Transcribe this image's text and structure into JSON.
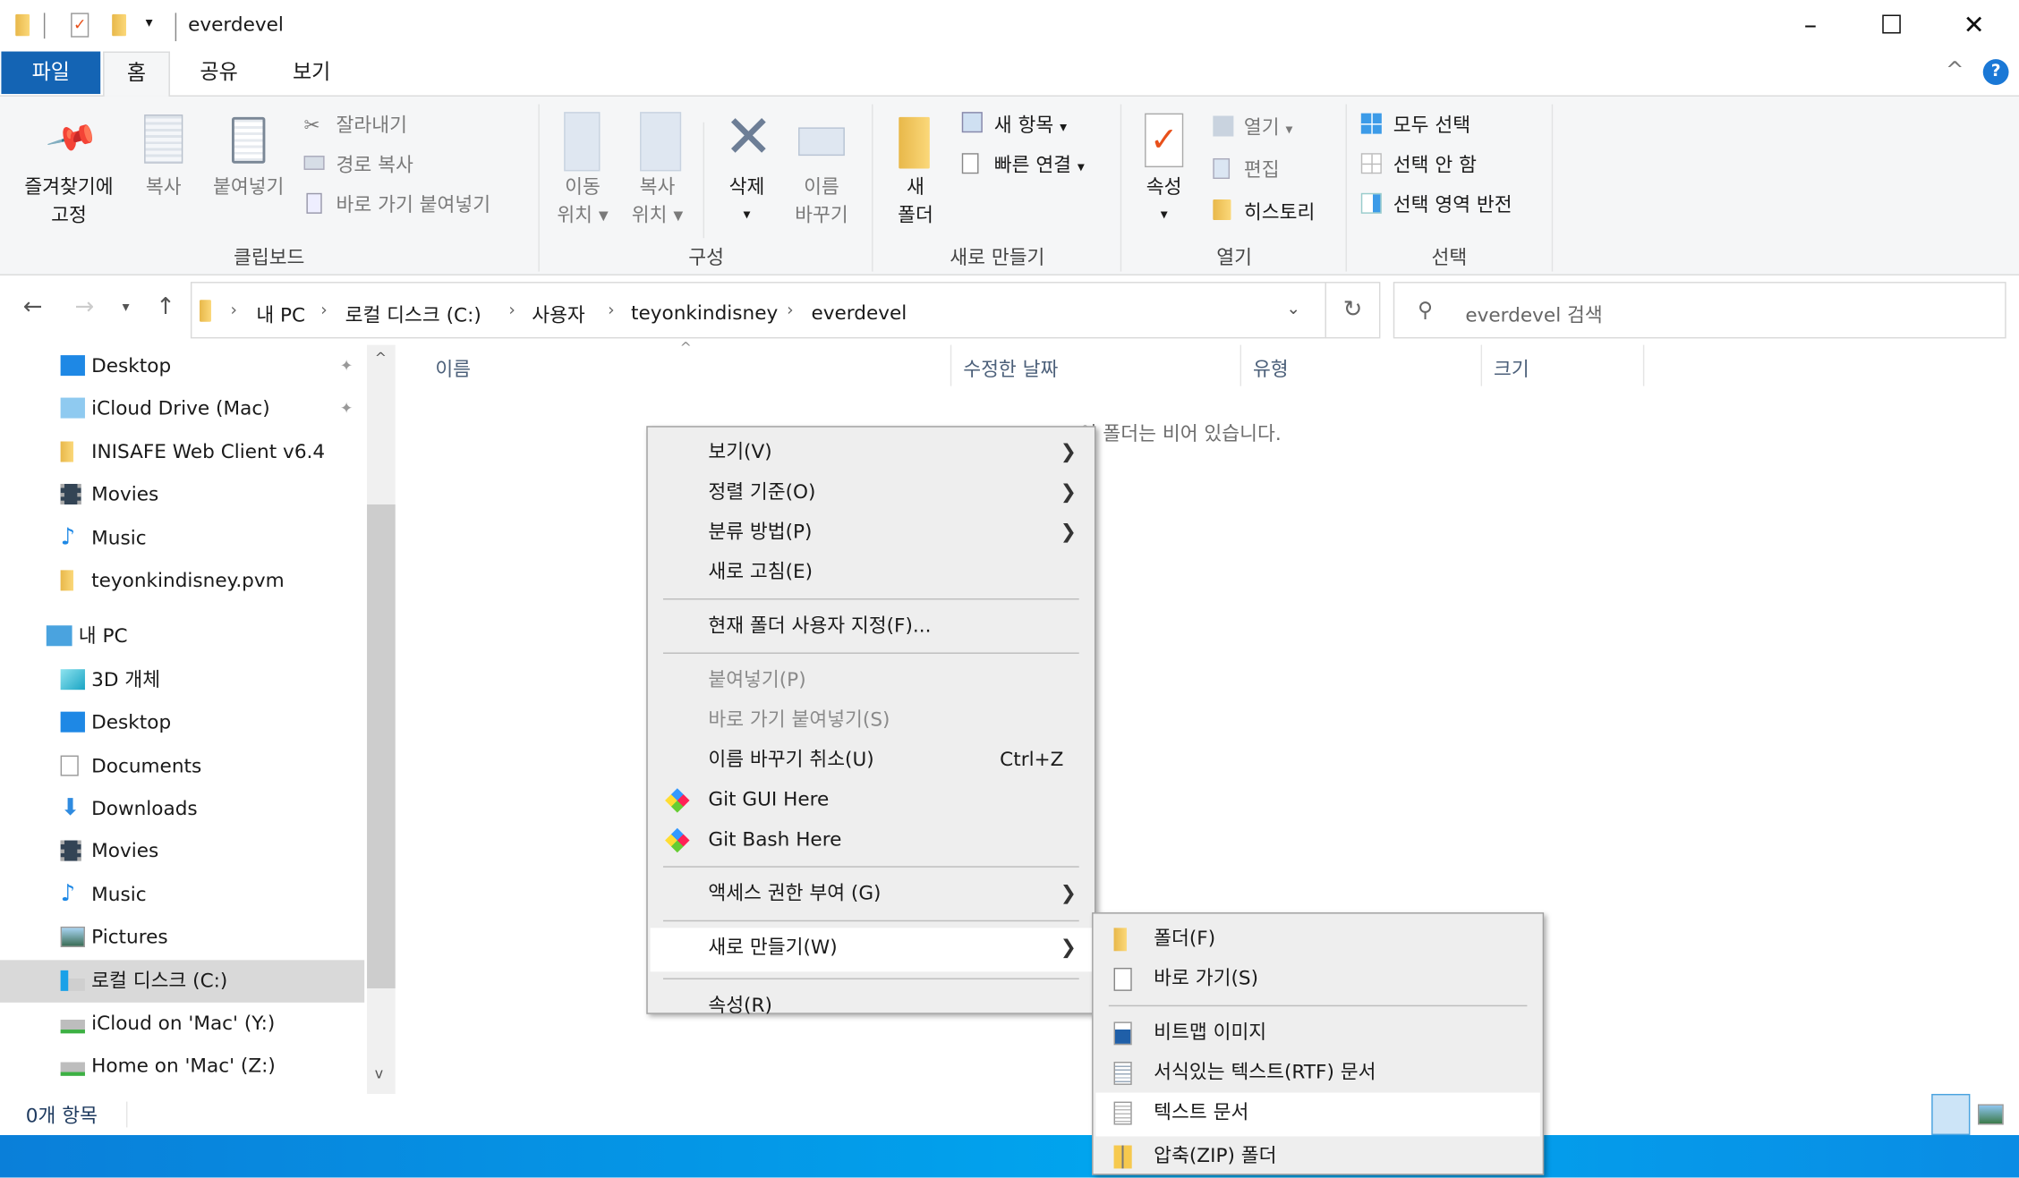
{
  "window": {
    "title": "everdevel",
    "controls": {
      "minimize": "–",
      "maximize": "☐",
      "close": "✕"
    }
  },
  "tabs": [
    {
      "label": "파일",
      "active": false
    },
    {
      "label": "홈",
      "active": true
    },
    {
      "label": "공유",
      "active": false
    },
    {
      "label": "보기",
      "active": false
    }
  ],
  "ribbon_right": {
    "collapse": "^",
    "help": "?"
  },
  "ribbon": {
    "clipboard": {
      "label": "클립보드",
      "pin_line1": "즐겨찾기에",
      "pin_line2": "고정",
      "copy": "복사",
      "paste": "붙여넣기",
      "cut": "잘라내기",
      "copy_path": "경로 복사",
      "paste_shortcut": "바로 가기 붙여넣기"
    },
    "organize": {
      "label": "구성",
      "move_line1": "이동",
      "move_line2": "위치",
      "copy_line1": "복사",
      "copy_line2": "위치",
      "delete": "삭제",
      "rename_line1": "이름",
      "rename_line2": "바꾸기"
    },
    "new": {
      "label": "새로 만들기",
      "folder_line1": "새",
      "folder_line2": "폴더",
      "new_item": "새 항목",
      "easy_access": "빠른 연결"
    },
    "open": {
      "label": "열기",
      "properties": "속성",
      "open": "열기",
      "edit": "편집",
      "history": "히스토리"
    },
    "select": {
      "label": "선택",
      "select_all": "모두 선택",
      "select_none": "선택 안 함",
      "invert": "선택 영역 반전"
    }
  },
  "address": {
    "crumbs": [
      "내 PC",
      "로컬 디스크 (C:)",
      "사용자",
      "teyonkindisney",
      "everdevel"
    ],
    "search_placeholder": "everdevel 검색"
  },
  "nav": {
    "items": [
      {
        "label": "Desktop",
        "icon": "desktop-icon",
        "pinned": true
      },
      {
        "label": "iCloud Drive (Mac)",
        "icon": "icloud-folder-icon",
        "pinned": true
      },
      {
        "label": "INISAFE Web Client v6.4",
        "icon": "folder-icon"
      },
      {
        "label": "Movies",
        "icon": "movies-icon"
      },
      {
        "label": "Music",
        "icon": "music-icon"
      },
      {
        "label": "teyonkindisney.pvm",
        "icon": "folder-icon"
      },
      {
        "label": "내 PC",
        "icon": "pc-icon",
        "root": true
      },
      {
        "label": "3D 개체",
        "icon": "3d-objects-icon"
      },
      {
        "label": "Desktop",
        "icon": "desktop-icon"
      },
      {
        "label": "Documents",
        "icon": "documents-icon"
      },
      {
        "label": "Downloads",
        "icon": "downloads-icon"
      },
      {
        "label": "Movies",
        "icon": "movies-icon"
      },
      {
        "label": "Music",
        "icon": "music-icon"
      },
      {
        "label": "Pictures",
        "icon": "pictures-icon"
      },
      {
        "label": "로컬 디스크 (C:)",
        "icon": "local-disk-icon",
        "selected": true
      },
      {
        "label": "iCloud on 'Mac' (Y:)",
        "icon": "network-drive-icon"
      },
      {
        "label": "Home on 'Mac' (Z:)",
        "icon": "network-drive-icon"
      }
    ]
  },
  "columns": [
    "이름",
    "수정한 날짜",
    "유형",
    "크기"
  ],
  "empty_message": "이 폴더는 비어 있습니다.",
  "status": {
    "item_count": "0개 항목"
  },
  "context_menu": {
    "items": [
      {
        "label": "보기(V)",
        "submenu": true
      },
      {
        "label": "정렬 기준(O)",
        "submenu": true
      },
      {
        "label": "분류 방법(P)",
        "submenu": true
      },
      {
        "label": "새로 고침(E)"
      },
      {
        "sep": true
      },
      {
        "label": "현재 폴더 사용자 지정(F)..."
      },
      {
        "sep": true
      },
      {
        "label": "붙여넣기(P)",
        "disabled": true
      },
      {
        "label": "바로 가기 붙여넣기(S)",
        "disabled": true
      },
      {
        "label": "이름 바꾸기 취소(U)",
        "shortcut": "Ctrl+Z"
      },
      {
        "label": "Git GUI Here",
        "icon": "git-icon"
      },
      {
        "label": "Git Bash Here",
        "icon": "git-icon"
      },
      {
        "sep": true
      },
      {
        "label": "액세스 권한 부여 (G)",
        "submenu": true
      },
      {
        "sep": true
      },
      {
        "label": "새로 만들기(W)",
        "submenu": true,
        "highlighted": true
      },
      {
        "sep": true
      },
      {
        "label": "속성(R)"
      }
    ]
  },
  "new_submenu": {
    "items": [
      {
        "label": "폴더(F)",
        "icon": "folder-icon"
      },
      {
        "label": "바로 가기(S)",
        "icon": "shortcut-icon"
      },
      {
        "sep": true
      },
      {
        "label": "비트맵 이미지",
        "icon": "bitmap-icon"
      },
      {
        "label": "서식있는 텍스트(RTF) 문서",
        "icon": "rtf-document-icon"
      },
      {
        "label": "텍스트 문서",
        "icon": "text-document-icon",
        "highlighted": true
      },
      {
        "label": "압축(ZIP) 폴더",
        "icon": "zip-folder-icon"
      }
    ]
  },
  "colors": {
    "file_tab": "#1464b4",
    "accent": "#0078d7",
    "menu_bg": "#eeeeee",
    "selected_nav": "#d9d9d9"
  }
}
